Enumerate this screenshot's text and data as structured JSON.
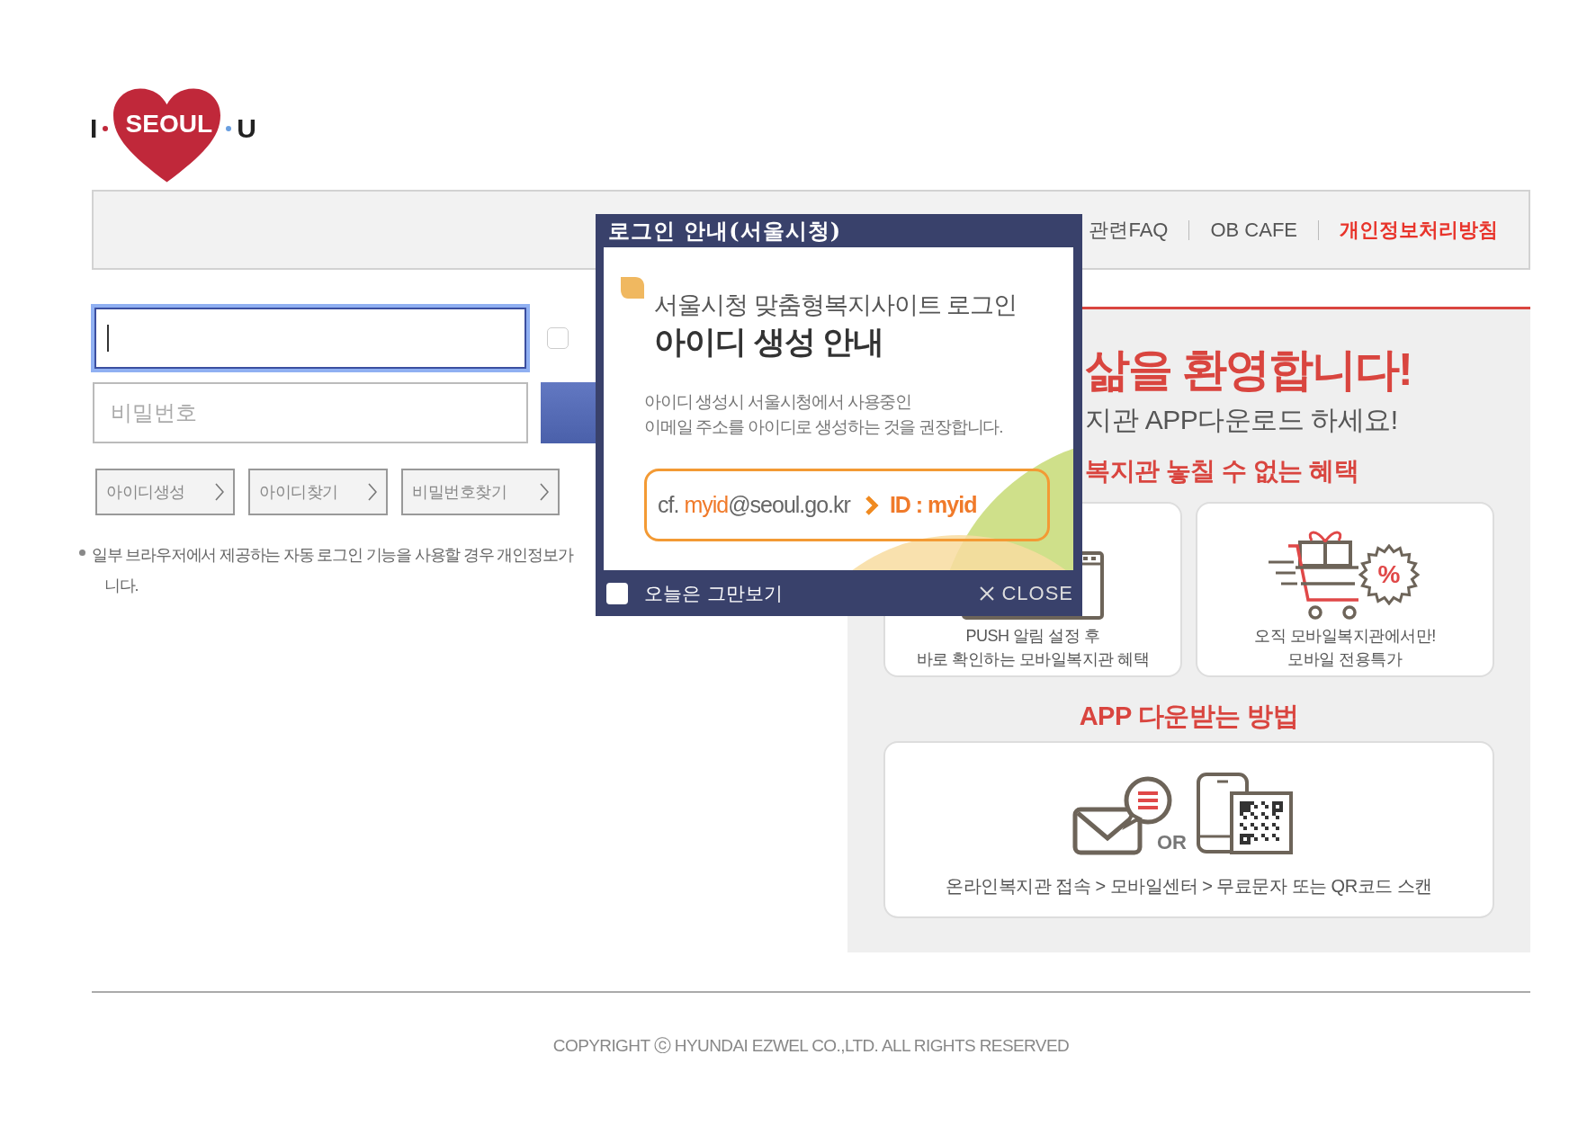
{
  "logo": {
    "left": "I",
    "center": "SEOUL",
    "right": "U"
  },
  "nav": {
    "items": [
      {
        "label": "관련FAQ",
        "kind": "normal"
      },
      {
        "label": "OB CAFE",
        "kind": "normal"
      },
      {
        "label": "개인정보처리방침",
        "kind": "highlight"
      }
    ]
  },
  "login": {
    "id_field": {
      "focused": true
    },
    "save_id": {
      "checked": false
    },
    "password_field": {
      "placeholder": "비밀번호"
    },
    "links": [
      "아이디생성",
      "아이디찾기",
      "비밀번호찾기"
    ],
    "notice": [
      "일부 브라우저에서 제공하는 자동 로그인 기능을 사용할 경우 개인정보가",
      "니다."
    ]
  },
  "promo": {
    "headline": "삶을 환영합니다!",
    "subtitle": "지관 APP다운로드 하세요!",
    "benefits_title": "복지관 놓칠 수 없는 혜택",
    "benefits": [
      {
        "kind": "push",
        "lines": [
          "PUSH 알림 설정 후",
          "바로 확인하는 모바일복지관 혜택"
        ]
      },
      {
        "kind": "sale",
        "badge": "%",
        "lines": [
          "오직 모바일복지관에서만!",
          "모바일 전용특가"
        ]
      }
    ],
    "method_title": "APP 다운받는 방법",
    "method": {
      "or": "OR",
      "steps": "온라인복지관 접속 > 모바일센터 > 무료문자 또는 QR코드 스캔"
    }
  },
  "popup": {
    "title": "로그인 안내(서울시청)",
    "heading": "서울시청 맞춤형복지사이트 로그인",
    "subheading": "아이디 생성 안내",
    "body": [
      "아이디 생성시 서울시청에서 사용중인",
      "이메일 주소를 아이디로 생성하는 것을 권장합니다."
    ],
    "example": {
      "prefix": "cf.",
      "email_user": "myid",
      "email_domain": "@seoul.go.kr",
      "result": "ID : myid"
    },
    "dont_show_today": {
      "label": "오늘은 그만보기",
      "checked": false
    },
    "close": "CLOSE"
  },
  "footer": {
    "copyright": "COPYRIGHT ⓒ HYUNDAI EZWEL CO.,LTD. ALL RIGHTS RESERVED"
  }
}
